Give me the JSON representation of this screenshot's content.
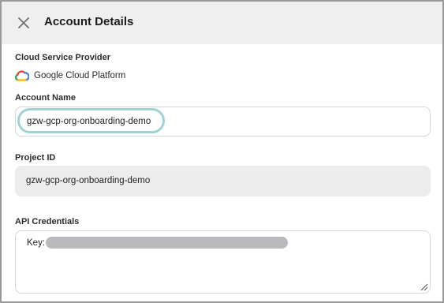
{
  "header": {
    "title": "Account Details",
    "close_icon": "close-icon"
  },
  "provider": {
    "label": "Cloud Service Provider",
    "name": "Google Cloud Platform",
    "icon": "google-cloud-icon"
  },
  "account_name": {
    "label": "Account Name",
    "value": "gzw-gcp-org-onboarding-demo"
  },
  "project_id": {
    "label": "Project ID",
    "value": "gzw-gcp-org-onboarding-demo"
  },
  "api_credentials": {
    "label": "API Credentials",
    "key_label": "Key:",
    "redacted": true
  },
  "colors": {
    "header_bg": "#efefef",
    "focus_ring": "#9fd3d3",
    "readonly_bg": "#ececec",
    "redaction": "#b9b9bd"
  }
}
